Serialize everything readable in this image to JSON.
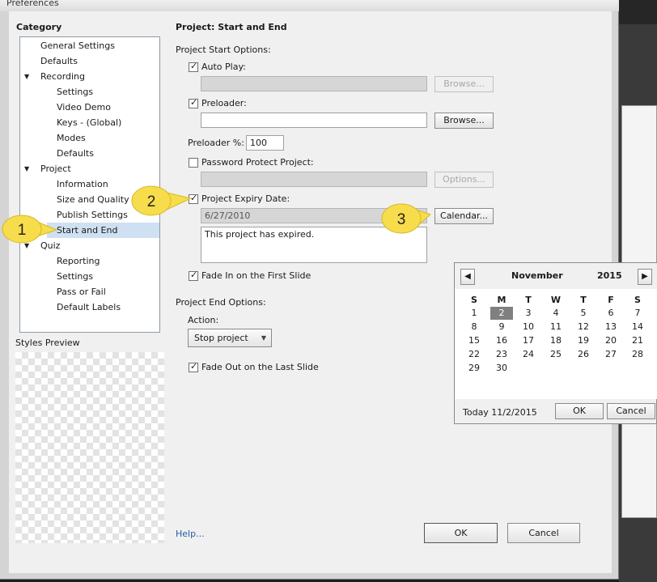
{
  "window": {
    "title": "Preferences"
  },
  "category": {
    "heading": "Category",
    "items": [
      {
        "label": "General Settings"
      },
      {
        "label": "Defaults"
      },
      {
        "label": "Recording"
      },
      {
        "label": "Settings"
      },
      {
        "label": "Video Demo"
      },
      {
        "label": "Keys - (Global)"
      },
      {
        "label": "Modes"
      },
      {
        "label": "Defaults"
      },
      {
        "label": "Project"
      },
      {
        "label": "Information"
      },
      {
        "label": "Size and Quality"
      },
      {
        "label": "Publish Settings"
      },
      {
        "label": "Start and End"
      },
      {
        "label": "Quiz"
      },
      {
        "label": "Reporting"
      },
      {
        "label": "Settings"
      },
      {
        "label": "Pass or Fail"
      },
      {
        "label": "Default Labels"
      }
    ],
    "selected": "Start and End"
  },
  "styles_preview": {
    "label": "Styles Preview"
  },
  "page": {
    "title": "Project: Start and End",
    "start_options_label": "Project Start Options:",
    "auto_play": {
      "label": "Auto Play:",
      "checked": true,
      "value": "",
      "browse": "Browse..."
    },
    "preloader": {
      "label": "Preloader:",
      "checked": true,
      "value": "",
      "browse": "Browse..."
    },
    "preloader_pct": {
      "label": "Preloader %:",
      "value": "100"
    },
    "password": {
      "label": "Password Protect Project:",
      "checked": false,
      "value": "",
      "options": "Options..."
    },
    "expiry": {
      "label": "Project Expiry Date:",
      "checked": true,
      "date": "6/27/2010",
      "calendar": "Calendar...",
      "message": "This project has expired."
    },
    "fade_in": {
      "label": "Fade In on the First Slide",
      "checked": true
    },
    "end_options_label": "Project End Options:",
    "action": {
      "label": "Action:",
      "value": "Stop project"
    },
    "fade_out": {
      "label": "Fade Out on the Last Slide",
      "checked": true
    }
  },
  "footer": {
    "help": "Help...",
    "ok": "OK",
    "cancel": "Cancel"
  },
  "callouts": [
    "1",
    "2",
    "3"
  ],
  "calendar": {
    "month": "November",
    "year": "2015",
    "weekdays": [
      "S",
      "M",
      "T",
      "W",
      "T",
      "F",
      "S"
    ],
    "weeks": [
      [
        "1",
        "2",
        "3",
        "4",
        "5",
        "6",
        "7"
      ],
      [
        "8",
        "9",
        "10",
        "11",
        "12",
        "13",
        "14"
      ],
      [
        "15",
        "16",
        "17",
        "18",
        "19",
        "20",
        "21"
      ],
      [
        "22",
        "23",
        "24",
        "25",
        "26",
        "27",
        "28"
      ],
      [
        "29",
        "30",
        "",
        "",
        "",
        "",
        ""
      ]
    ],
    "highlighted": "2",
    "today": "Today 11/2/2015",
    "ok": "OK",
    "cancel": "Cancel"
  },
  "colors": {
    "callout": "#f7dc4c",
    "selection": "#cfe0f2",
    "today_cell": "#808080"
  }
}
